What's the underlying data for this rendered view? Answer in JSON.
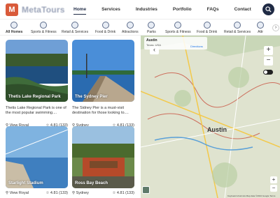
{
  "brand": {
    "name": "MetaTours",
    "mark": "M"
  },
  "menu": [
    {
      "label": "Home"
    },
    {
      "label": "Services"
    },
    {
      "label": "Industries"
    },
    {
      "label": "Portfolio"
    },
    {
      "label": "FAQs"
    },
    {
      "label": "Contact"
    }
  ],
  "categories": [
    {
      "label": "All Homes"
    },
    {
      "label": "Sports & Fitness"
    },
    {
      "label": "Retail & Services"
    },
    {
      "label": "Food & Drink"
    },
    {
      "label": "Attractions"
    },
    {
      "label": "Parks"
    },
    {
      "label": "Sports & Fitness"
    },
    {
      "label": "Food & Drink"
    },
    {
      "label": "Retail & Services"
    },
    {
      "label": "Attr"
    }
  ],
  "cards": [
    {
      "title": "Thetis Lake Regional Park",
      "desc": "Thetis Lake Regional Park is one of the most popular swimming....",
      "location": "View Royal",
      "rating": "4.81 (133)"
    },
    {
      "title": "The Sydney Pier",
      "desc": "The Sidney Pier is a must-visit destination for those looking to....",
      "location": "Sydney",
      "rating": "4.81 (133)"
    },
    {
      "title": "Starlight Stadium",
      "desc": "",
      "location": "View Royal",
      "rating": "4.81 (133)"
    },
    {
      "title": "Ross Bay Beach",
      "desc": "",
      "location": "Sydney",
      "rating": "4.81 (133)"
    }
  ],
  "map": {
    "info_title": "Austin",
    "info_sub": "Texas, USA",
    "info_dir": "Directions",
    "city_label": "Austin",
    "footer": "Keyboard shortcuts   Map data ©2024 Google   Terms"
  },
  "colors": {
    "accent": "#1f2a44",
    "brand": "#d95a3a"
  }
}
